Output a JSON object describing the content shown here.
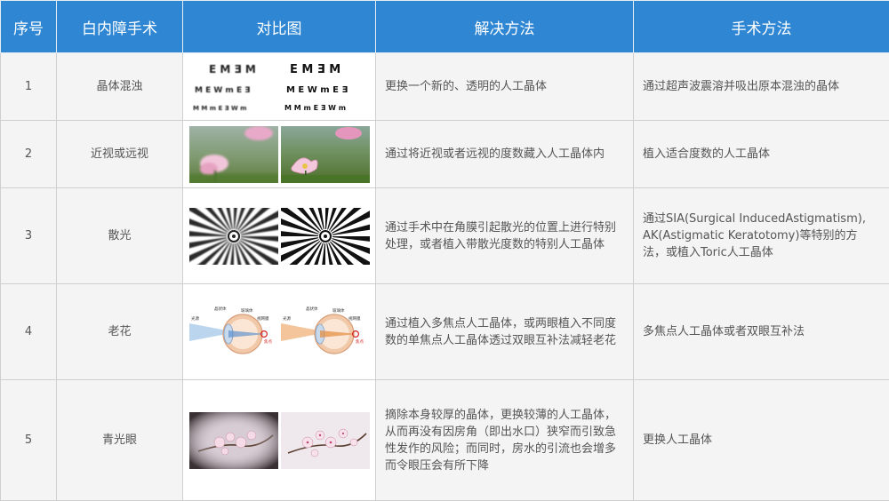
{
  "headers": [
    "序号",
    "白内障手术",
    "对比图",
    "解决方法",
    "手术方法"
  ],
  "rows": [
    {
      "no": "1",
      "name": "晶体混浊",
      "solution": "更换一个新的、透明的人工晶体",
      "method": "通过超声波震溶并吸出原本混浊的晶体"
    },
    {
      "no": "2",
      "name": "近视或远视",
      "solution": "通过将近视或者远视的度数藏入人工晶体内",
      "method": "植入适合度数的人工晶体"
    },
    {
      "no": "3",
      "name": "散光",
      "solution": "通过手术中在角膜引起散光的位置上进行特别处理，或者植入带散光度数的特别人工晶体",
      "method": "通过SIA(Surgical InducedAstigmatism), AK(Astigmatic Keratotomy)等特别的方法，或植入Toric人工晶体"
    },
    {
      "no": "4",
      "name": "老花",
      "solution": "通过植入多焦点人工晶体，或两眼植入不同度数的单焦点人工晶体透过双眼互补法减轻老花",
      "method": "多焦点人工晶体或者双眼互补法"
    },
    {
      "no": "5",
      "name": "青光眼",
      "solution": "摘除本身较厚的晶体，更换较薄的人工晶体，从而再没有因房角（即出水口）狭窄而引致急性发作的风险；而同时，房水的引流也会增多而令眼压会有所下降",
      "method": "更换人工晶体"
    }
  ],
  "eye_chart": {
    "row1": "E M Ǝ M",
    "row2": "M E W m E Ǝ",
    "row3": "M M m E Ǝ W m"
  },
  "diagram_labels": {
    "lens": "晶状体",
    "ciliary": "玻璃体",
    "retina": "视网膜",
    "light": "光源",
    "focus": "焦点"
  }
}
